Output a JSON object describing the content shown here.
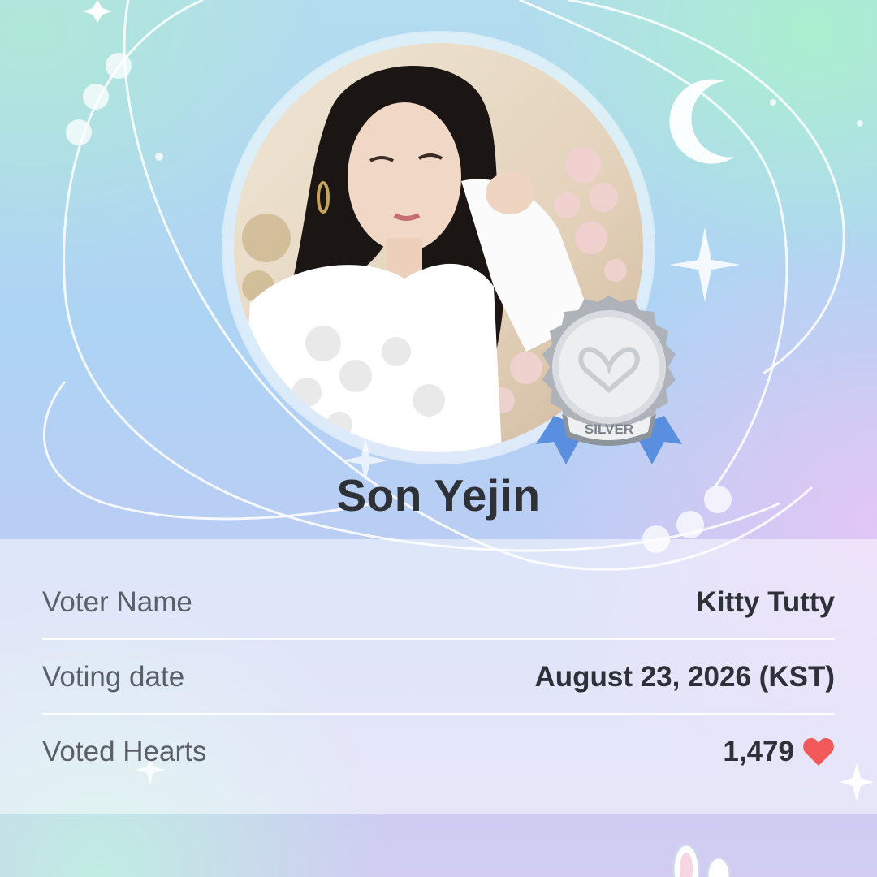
{
  "card": {
    "artist_name": "Son Yejin",
    "badge": {
      "label": "SILVER",
      "icon": "heart-loop-icon",
      "color": "#bfc3c9"
    }
  },
  "details": {
    "rows": [
      {
        "label": "Voter Name",
        "value": "Kitty Tutty"
      },
      {
        "label": "Voting date",
        "value": "August 23, 2026 (KST)"
      },
      {
        "label": "Voted Hearts",
        "value": "1,479",
        "icon": "heart-icon"
      }
    ]
  },
  "colors": {
    "heart": "#f25a5a",
    "text_primary": "#2e3238",
    "text_secondary": "#5b6068",
    "ribbon": "#5a8fe0"
  }
}
